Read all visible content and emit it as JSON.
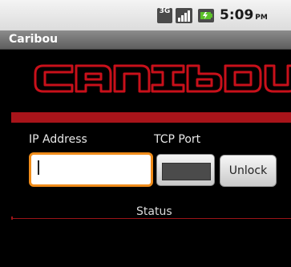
{
  "status_bar": {
    "network_type": "3G",
    "time": "5:09",
    "am_pm": "PM",
    "icons": [
      "3g-icon",
      "signal-icon",
      "battery-charging-icon"
    ]
  },
  "app": {
    "title": "Caribou",
    "logo_text": "caribou",
    "accent_color": "#c8101a",
    "focus_color": "#f08c1a"
  },
  "form": {
    "ip_label": "IP Address",
    "ip_value": "",
    "port_label": "TCP Port",
    "port_value": "",
    "unlock_label": "Unlock"
  },
  "status": {
    "label": "Status"
  }
}
